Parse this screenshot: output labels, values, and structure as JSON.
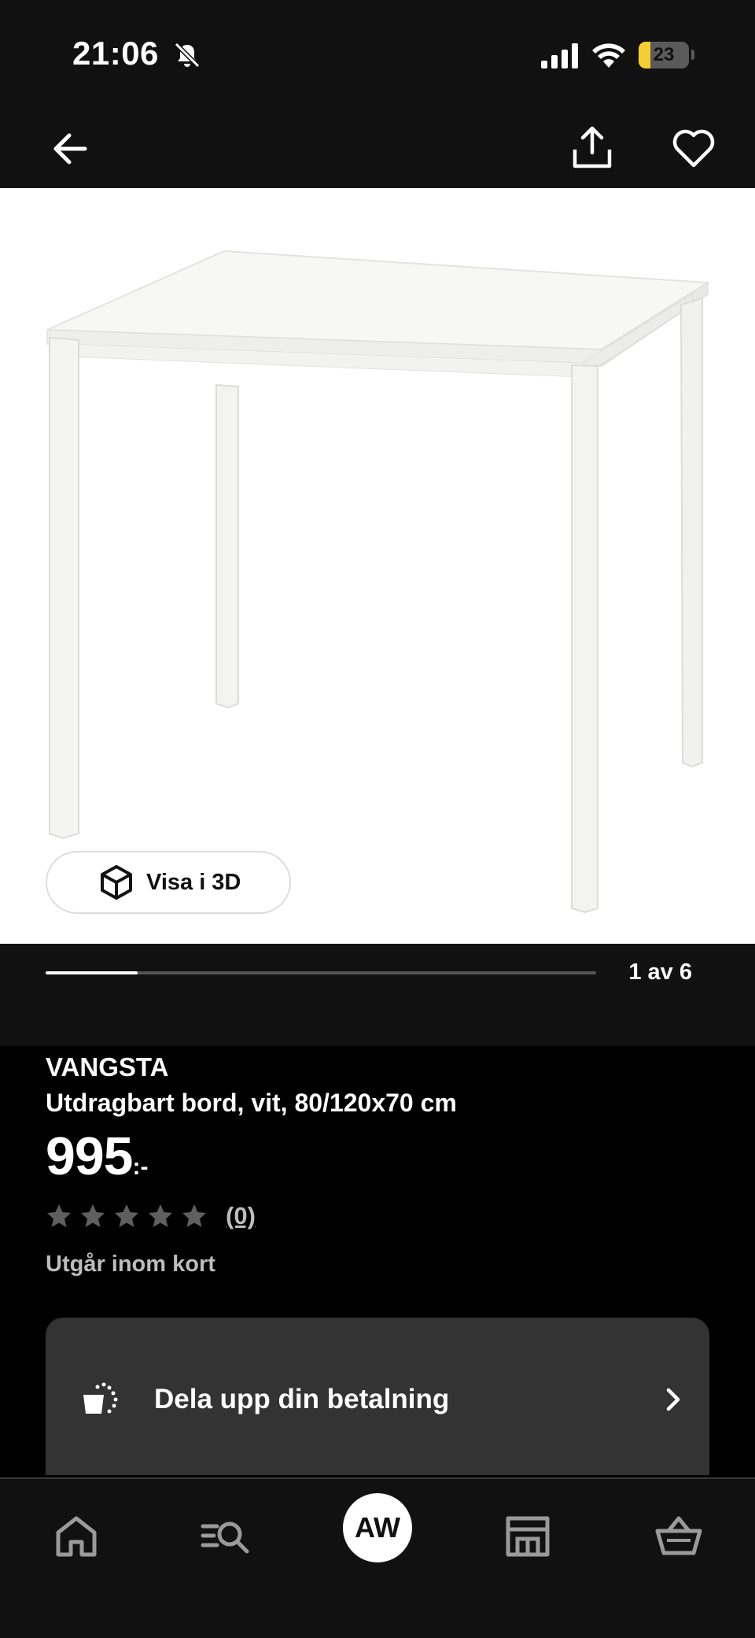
{
  "status_bar": {
    "time": "21:06",
    "battery_level": "23",
    "battery_fraction": 0.23,
    "icons": [
      "bell-slash-icon",
      "signal-icon",
      "wifi-icon",
      "battery-icon"
    ]
  },
  "top_nav": {
    "icons": [
      "arrow-left-icon",
      "share-icon",
      "heart-icon"
    ]
  },
  "image_gallery": {
    "view_3d_label": "Visa i 3D",
    "page_indicator": "1 av 6",
    "current_image": 1,
    "total_images": 6
  },
  "product": {
    "name": "VANGSTA",
    "description": "Utdragbart bord, vit, 80/120x70 cm",
    "price": "995",
    "price_suffix": ":-",
    "rating": 0,
    "max_stars": 5,
    "review_count": "(0)",
    "availability": "Utgår inom kort"
  },
  "payment": {
    "label": "Dela upp din betalning"
  },
  "bottom_nav": {
    "avatar_initials": "AW",
    "items": [
      "home-icon",
      "search-list-icon",
      "avatar",
      "store-icon",
      "basket-icon"
    ]
  },
  "colors": {
    "header_bg": "#111111",
    "page_bg": "#000000",
    "card_bg": "#333333",
    "battery_yellow": "#f5cf2f"
  }
}
